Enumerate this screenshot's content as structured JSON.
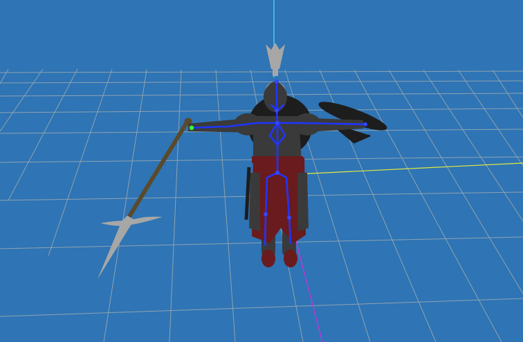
{
  "viewport": {
    "background": "#2f74b4",
    "grid_color": "#8da4b2",
    "axis_colors": {
      "vertical": "#49e6ff",
      "x_axis": "#e4ea40",
      "z_axis": "#d82be0"
    }
  },
  "character": {
    "armor_color": "#3a3a3a",
    "armor_dark": "#1d1d1d",
    "fabric_color": "#6a1b1d",
    "metal_color": "#a7a7a7",
    "spear_shaft": "#5a4a2c"
  },
  "skeleton": {
    "bone_color": "#1f35ff",
    "joint_color": "#3346ff",
    "selected_joint_color": "#34ff3a"
  }
}
